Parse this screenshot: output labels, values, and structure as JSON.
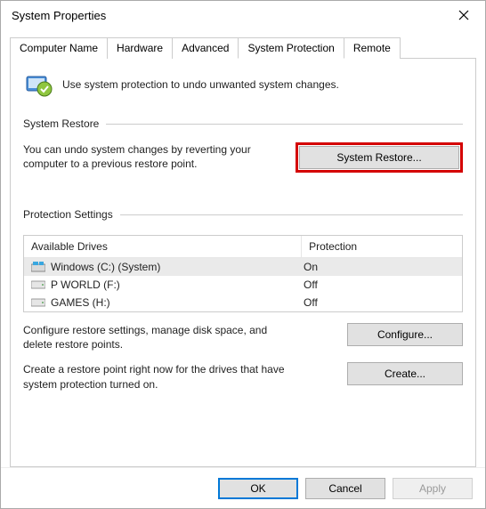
{
  "window": {
    "title": "System Properties"
  },
  "tabs": [
    {
      "label": "Computer Name"
    },
    {
      "label": "Hardware"
    },
    {
      "label": "Advanced"
    },
    {
      "label": "System Protection"
    },
    {
      "label": "Remote"
    }
  ],
  "intro": {
    "text": "Use system protection to undo unwanted system changes."
  },
  "restore": {
    "header": "System Restore",
    "desc": "You can undo system changes by reverting your computer to a previous restore point.",
    "button": "System Restore..."
  },
  "protection": {
    "header": "Protection Settings",
    "columns": {
      "drive": "Available Drives",
      "prot": "Protection"
    },
    "rows": [
      {
        "name": "Windows (C:) (System)",
        "prot": "On",
        "icon": "system"
      },
      {
        "name": "P WORLD (F:)",
        "prot": "Off",
        "icon": "hdd"
      },
      {
        "name": "GAMES (H:)",
        "prot": "Off",
        "icon": "hdd"
      }
    ],
    "configure": {
      "desc": "Configure restore settings, manage disk space, and delete restore points.",
      "button": "Configure..."
    },
    "create": {
      "desc": "Create a restore point right now for the drives that have system protection turned on.",
      "button": "Create..."
    }
  },
  "footer": {
    "ok": "OK",
    "cancel": "Cancel",
    "apply": "Apply"
  }
}
